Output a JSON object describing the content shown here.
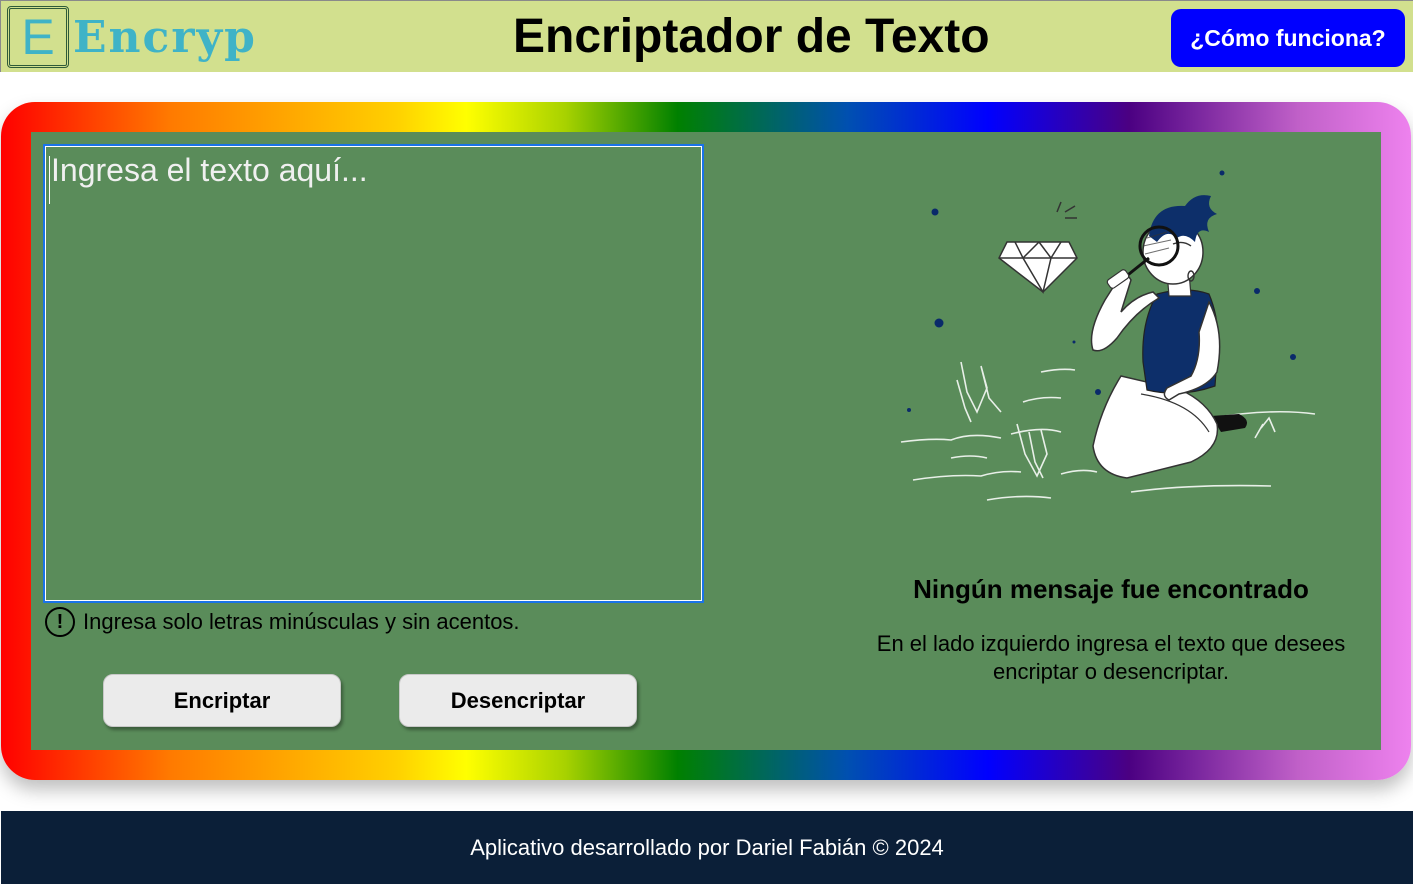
{
  "header": {
    "logo_letter": "E",
    "logo_text": "Encryp",
    "title": "Encriptador de Texto",
    "how_button": "¿Cómo funciona?"
  },
  "editor": {
    "placeholder": "Ingresa el texto aquí...",
    "value": "",
    "hint_icon": "!",
    "hint": "Ingresa solo letras minúsculas y sin acentos."
  },
  "actions": {
    "encrypt": "Encriptar",
    "decrypt": "Desencriptar"
  },
  "output": {
    "illustration": "person-magnifying-diamond-illustration",
    "title": "Ningún mensaje fue encontrado",
    "body": "En el lado izquierdo ingresa el texto que desees encriptar o desencriptar."
  },
  "footer": {
    "text": "Aplicativo desarrollado por Dariel Fabián © 2024"
  },
  "colors": {
    "header_bg": "#d2e08e",
    "panel_bg": "#5a8c5a",
    "how_button_bg": "#0000ff",
    "footer_bg": "#0b1f38",
    "logo": "#3fb3c7"
  }
}
